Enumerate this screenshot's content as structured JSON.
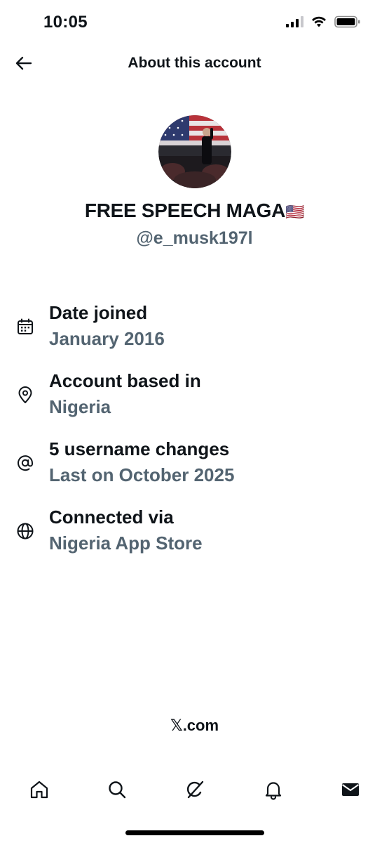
{
  "status_bar": {
    "time": "10:05",
    "icons": [
      "cellular-signal-icon",
      "wifi-icon",
      "battery-icon"
    ]
  },
  "header": {
    "back_icon": "arrow-left-icon",
    "title": "About this account"
  },
  "profile": {
    "avatar_text": "America",
    "display_name": "FREE SPEECH MAGA",
    "display_name_flag": "🇺🇸",
    "handle": "@e_musk197l"
  },
  "info": [
    {
      "icon": "calendar-icon",
      "label": "Date joined",
      "value": "January 2016"
    },
    {
      "icon": "location-pin-icon",
      "label": "Account based in",
      "value": "Nigeria"
    },
    {
      "icon": "at-sign-icon",
      "label": "5 username changes",
      "value": "Last on October 2025"
    },
    {
      "icon": "globe-icon",
      "label": "Connected via",
      "value": "Nigeria App Store"
    }
  ],
  "footer": {
    "brand_x": "𝕏",
    "brand_suffix": ".com"
  },
  "tab_bar": {
    "tabs": [
      "home-icon",
      "search-icon",
      "grok-icon",
      "notifications-bell-icon",
      "messages-envelope-icon"
    ]
  },
  "colors": {
    "primary_text": "#0f1419",
    "secondary_text": "#536471",
    "background": "#ffffff"
  }
}
